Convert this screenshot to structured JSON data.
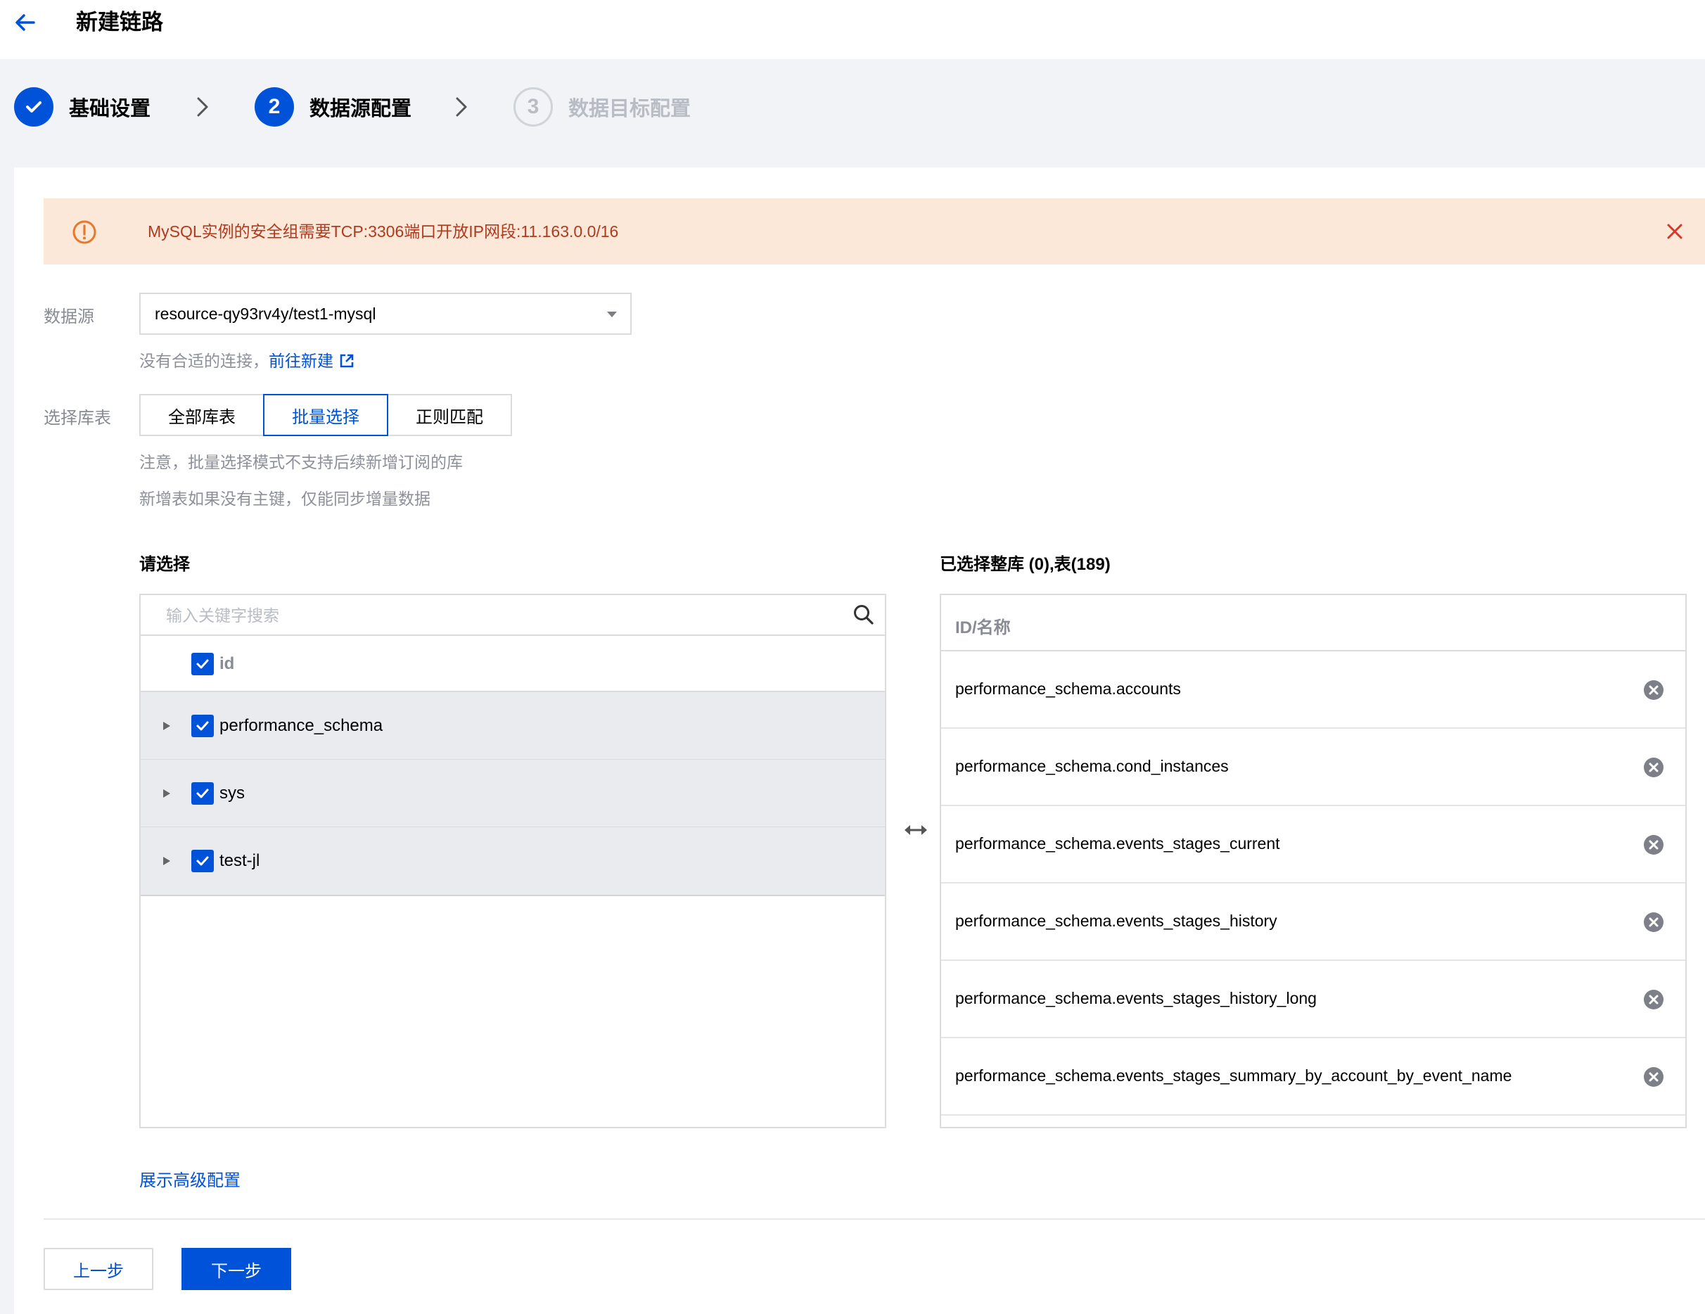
{
  "header": {
    "title": "新建链路"
  },
  "steps": [
    {
      "number": "",
      "label": "基础设置",
      "state": "done"
    },
    {
      "number": "2",
      "label": "数据源配置",
      "state": "active"
    },
    {
      "number": "3",
      "label": "数据目标配置",
      "state": "todo"
    }
  ],
  "alert": {
    "text": "MySQL实例的安全组需要TCP:3306端口开放IP网段:11.163.0.0/16"
  },
  "form": {
    "datasource_label": "数据源",
    "datasource_value": "resource-qy93rv4y/test1-mysql",
    "no_conn_hint": "没有合适的连接，",
    "create_link": "前往新建",
    "select_tables_label": "选择库表",
    "modes": [
      "全部库表",
      "批量选择",
      "正则匹配"
    ],
    "active_mode": "批量选择",
    "note1": "注意，批量选择模式不支持后续新增订阅的库",
    "note2": "新增表如果没有主键，仅能同步增量数据"
  },
  "left": {
    "title": "请选择",
    "search_placeholder": "输入关键字搜索",
    "header_label": "id",
    "rows": [
      "performance_schema",
      "sys",
      "test-jl"
    ]
  },
  "right": {
    "title": "已选择整库 (0),表(189)",
    "header_label": "ID/名称",
    "rows": [
      "performance_schema.accounts",
      "performance_schema.cond_instances",
      "performance_schema.events_stages_current",
      "performance_schema.events_stages_history",
      "performance_schema.events_stages_history_long",
      "performance_schema.events_stages_summary_by_account_by_event_name"
    ]
  },
  "footer": {
    "advanced_link": "展示高级配置",
    "prev_label": "上一步",
    "next_label": "下一步"
  },
  "colors": {
    "primary": "#0052d9",
    "alert_bg": "#fbe8d8",
    "alert_text": "#b03a1e",
    "page_bg": "#f2f3f7"
  }
}
